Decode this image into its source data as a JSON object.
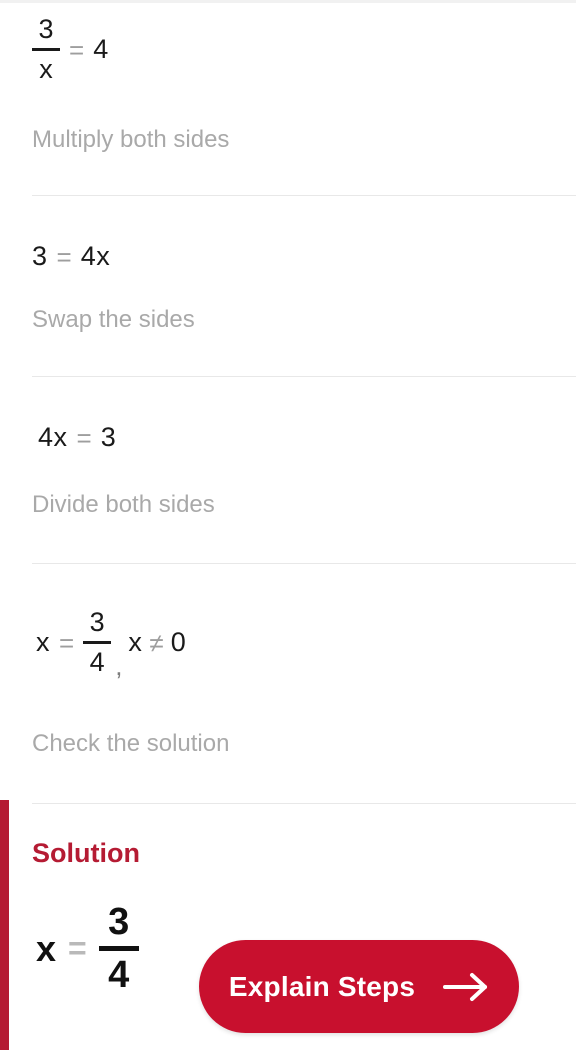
{
  "problem": {
    "original_equation": {
      "numerator": "3",
      "denominator": "x",
      "operator": "=",
      "right": "4"
    }
  },
  "steps": [
    {
      "equation_text": "3/x = 4",
      "numerator": "3",
      "denominator": "x",
      "operator": "=",
      "right": "4",
      "label": "Multiply both sides"
    },
    {
      "equation_text": "3 = 4 x",
      "left": "3",
      "operator": "=",
      "coefficient": "4",
      "variable": "x",
      "label": "Swap the sides"
    },
    {
      "equation_text": "4 x = 3",
      "coefficient": "4",
      "variable": "x",
      "operator": "=",
      "right": "3",
      "label": "Divide both sides"
    },
    {
      "equation_text": "x = 3/4 , x ≠ 0",
      "variable": "x",
      "operator": "=",
      "numerator": "3",
      "denominator": "4",
      "comma": ",",
      "constraint_variable": "x",
      "constraint_operator": "≠",
      "constraint_value": "0",
      "label": "Check the solution"
    }
  ],
  "solution": {
    "title": "Solution",
    "variable": "x",
    "operator": "=",
    "numerator": "3",
    "denominator": "4",
    "accent_color": "#b51b33"
  },
  "button": {
    "label": "Explain Steps",
    "icon": "arrow-right-icon",
    "background_color": "#c8102e",
    "text_color": "#ffffff"
  },
  "colors": {
    "equation_text": "#1a1a1a",
    "step_label": "#a9a9a9",
    "operator": "#9e9e9e",
    "divider": "#e8e8e8",
    "brand_red": "#c8102e",
    "solution_red": "#b51b33",
    "background": "#ffffff"
  }
}
